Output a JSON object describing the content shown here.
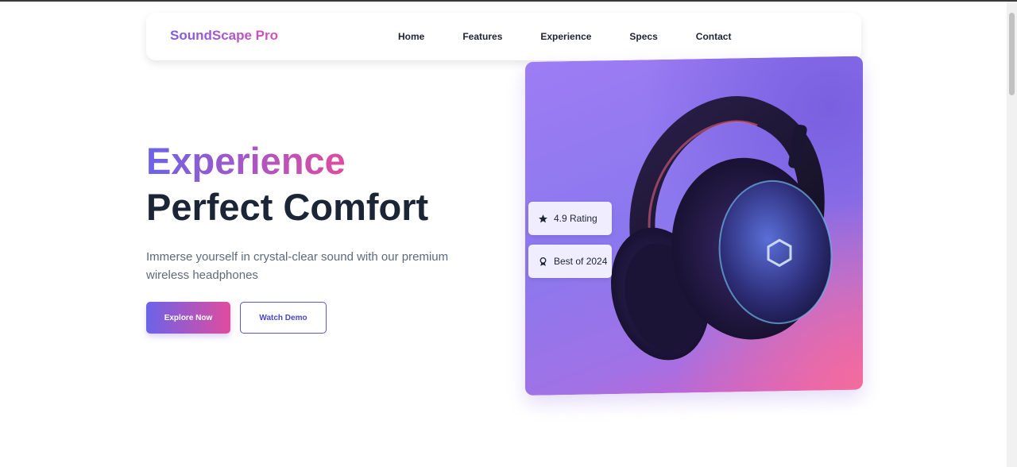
{
  "brand": {
    "name": "SoundScape Pro"
  },
  "nav": {
    "items": [
      "Home",
      "Features",
      "Experience",
      "Specs",
      "Contact"
    ]
  },
  "hero": {
    "title_line1": "Experience",
    "title_line2": "Perfect Comfort",
    "subtitle": "Immerse yourself in crystal-clear sound with our premium wireless headphones",
    "primary_button": "Explore Now",
    "secondary_button": "Watch Demo"
  },
  "badges": {
    "rating": {
      "icon": "star-icon",
      "label": "4.9 Rating"
    },
    "award": {
      "icon": "award-icon",
      "label": "Best of 2024"
    }
  },
  "colors": {
    "accent_start": "#6b63e9",
    "accent_end": "#e04c9e",
    "heading": "#1c2536",
    "body_text": "#5d6a7d"
  }
}
